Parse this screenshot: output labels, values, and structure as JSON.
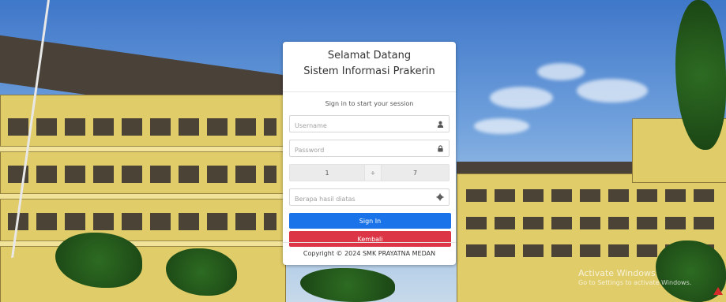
{
  "card": {
    "title_line1": "Selamat Datang",
    "title_line2": "Sistem Informasi Prakerin",
    "subtitle": "Sign in to start your session"
  },
  "form": {
    "username_placeholder": "Username",
    "password_placeholder": "Password",
    "captcha_a": "1",
    "captcha_operator": "+",
    "captcha_b": "7",
    "answer_placeholder": "Berapa hasil diatas",
    "signin_label": "Sign In",
    "back_label": "Kembali"
  },
  "footer": {
    "copyright": "Copyright © 2024 SMK PRAYATNA MEDAN"
  },
  "watermark": {
    "line1": "Activate Windows",
    "line2": "Go to Settings to activate Windows."
  },
  "icons": {
    "username": "user-icon",
    "password": "lock-icon",
    "answer": "gear-icon"
  },
  "colors": {
    "primary": "#1a73e8",
    "danger": "#dc3545"
  }
}
